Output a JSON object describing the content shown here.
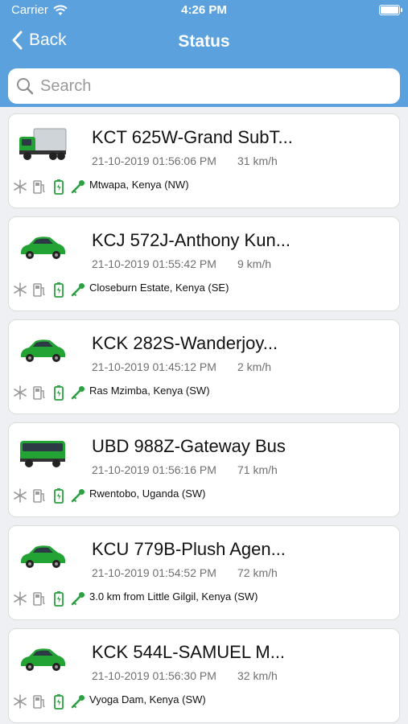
{
  "status_bar": {
    "carrier": "Carrier",
    "time": "4:26 PM",
    "battery_level": 1.0
  },
  "nav": {
    "back_label": "Back",
    "title": "Status"
  },
  "search": {
    "placeholder": "Search",
    "value": ""
  },
  "colors": {
    "header": "#5aa1de",
    "vehicle_green": "#22a333",
    "status_icon_gray": "#9b9b9b",
    "status_icon_green": "#2aa040"
  },
  "vehicles": [
    {
      "title": "KCT 625W-Grand SubT...",
      "time": "21-10-2019 01:56:06 PM",
      "speed": "31 km/h",
      "location": "Mtwapa, Kenya (NW)",
      "type": "truck-icon"
    },
    {
      "title": "KCJ 572J-Anthony Kun...",
      "time": "21-10-2019 01:55:42 PM",
      "speed": "9 km/h",
      "location": "Closeburn Estate, Kenya (SE)",
      "type": "car-icon"
    },
    {
      "title": "KCK 282S-Wanderjoy...",
      "time": "21-10-2019 01:45:12 PM",
      "speed": "2 km/h",
      "location": "Ras Mzimba, Kenya (SW)",
      "type": "car-icon"
    },
    {
      "title": "UBD 988Z-Gateway Bus",
      "time": "21-10-2019 01:56:16 PM",
      "speed": "71 km/h",
      "location": "Rwentobo, Uganda (SW)",
      "type": "bus-icon"
    },
    {
      "title": "KCU 779B-Plush Agen...",
      "time": "21-10-2019 01:54:52 PM",
      "speed": "72 km/h",
      "location": "3.0 km from Little Gilgil, Kenya (SW)",
      "type": "car-icon"
    },
    {
      "title": "KCK 544L-SAMUEL M...",
      "time": "21-10-2019 01:56:30 PM",
      "speed": "32 km/h",
      "location": "Vyoga Dam, Kenya (SW)",
      "type": "car-icon"
    }
  ]
}
